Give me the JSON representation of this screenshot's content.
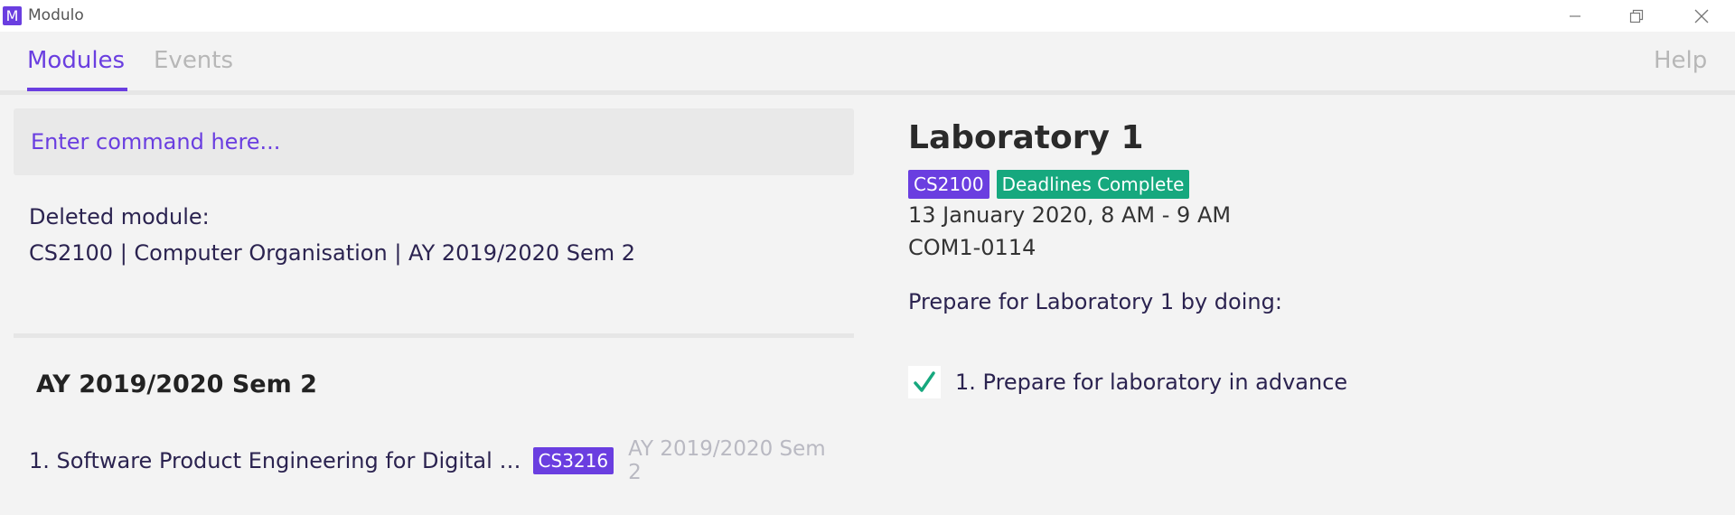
{
  "window": {
    "app_icon_letter": "M",
    "title": "Modulo"
  },
  "tabs": {
    "modules": "Modules",
    "events": "Events",
    "help": "Help"
  },
  "command": {
    "placeholder": "Enter command here..."
  },
  "result": {
    "line1": "Deleted module:",
    "line2": "CS2100 | Computer Organisation | AY 2019/2020 Sem 2"
  },
  "module_list": {
    "heading": "AY 2019/2020 Sem 2",
    "items": [
      {
        "name": "1. Software Product Engineering for Digital Ma...",
        "code": "CS3216",
        "semester": "AY 2019/2020 Sem 2"
      }
    ]
  },
  "event": {
    "title": "Laboratory 1",
    "module_code": "CS2100",
    "status": "Deadlines Complete",
    "datetime": "13 January 2020, 8 AM - 9 AM",
    "location": "COM1-0114",
    "prepare_label": "Prepare for Laboratory 1 by doing:",
    "deadlines": [
      {
        "text": "1. Prepare for laboratory in advance",
        "done": true
      }
    ]
  },
  "colors": {
    "accent": "#6a3ee0",
    "complete": "#16a87e",
    "check": "#16a87e"
  },
  "icons": {
    "minimize": "minimize-icon",
    "maximize": "restore-icon",
    "close": "close-icon",
    "check": "check-icon"
  }
}
